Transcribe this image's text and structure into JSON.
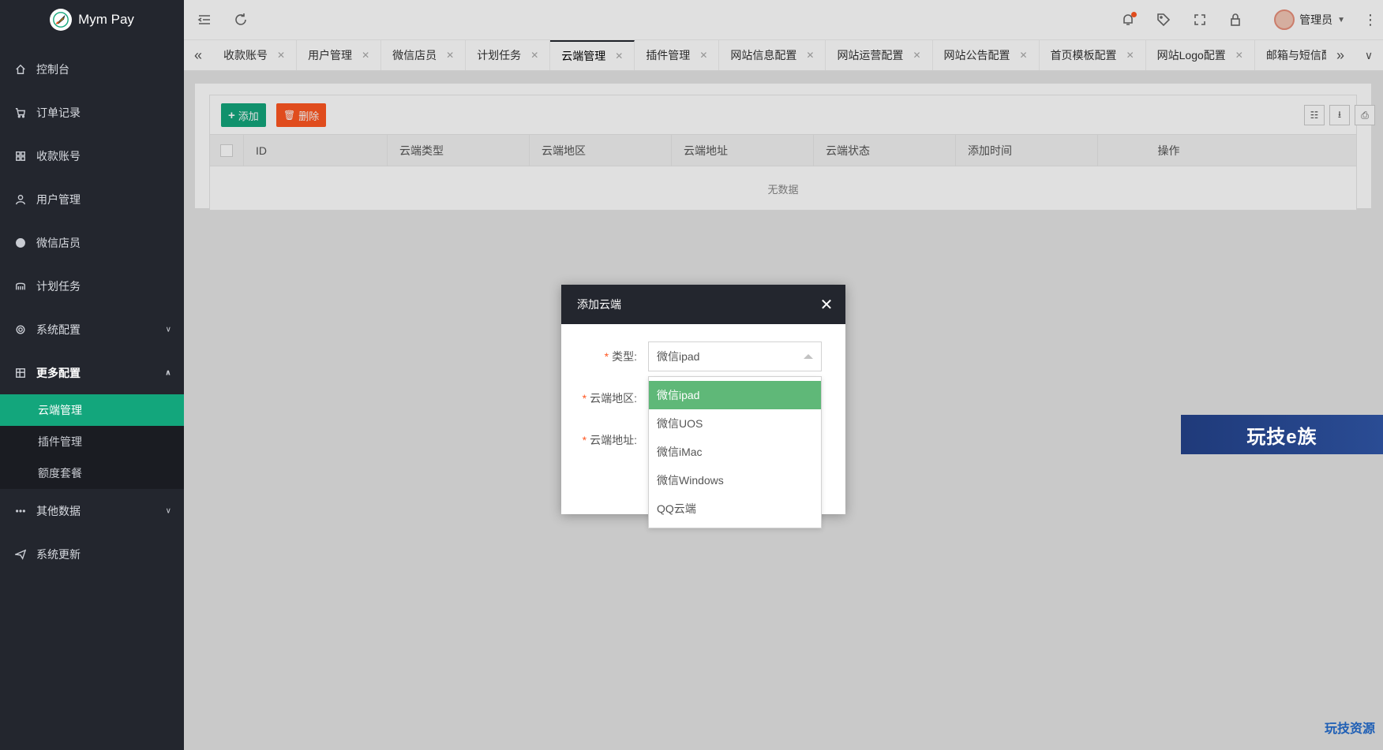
{
  "app": {
    "name": "Mym Pay"
  },
  "sidebar": {
    "items": [
      {
        "label": "控制台",
        "icon": "home-icon"
      },
      {
        "label": "订单记录",
        "icon": "cart-icon"
      },
      {
        "label": "收款账号",
        "icon": "apps-icon"
      },
      {
        "label": "用户管理",
        "icon": "user-icon"
      },
      {
        "label": "微信店员",
        "icon": "wechat-icon"
      },
      {
        "label": "计划任务",
        "icon": "group-icon"
      },
      {
        "label": "系统配置",
        "icon": "gear-icon",
        "expandable": true,
        "expanded": false
      },
      {
        "label": "更多配置",
        "icon": "grid-icon",
        "expandable": true,
        "expanded": true
      },
      {
        "label": "其他数据",
        "icon": "more-icon",
        "expandable": true,
        "expanded": false
      },
      {
        "label": "系统更新",
        "icon": "send-icon"
      }
    ],
    "sub_items": [
      {
        "label": "云端管理",
        "active": true
      },
      {
        "label": "插件管理",
        "active": false
      },
      {
        "label": "额度套餐",
        "active": false
      }
    ]
  },
  "header": {
    "user_name": "管理员",
    "has_notification": true
  },
  "tabs": [
    {
      "label": "收款账号",
      "active": false
    },
    {
      "label": "用户管理",
      "active": false
    },
    {
      "label": "微信店员",
      "active": false
    },
    {
      "label": "计划任务",
      "active": false
    },
    {
      "label": "云端管理",
      "active": true
    },
    {
      "label": "插件管理",
      "active": false
    },
    {
      "label": "网站信息配置",
      "active": false
    },
    {
      "label": "网站运营配置",
      "active": false
    },
    {
      "label": "网站公告配置",
      "active": false
    },
    {
      "label": "首页模板配置",
      "active": false
    },
    {
      "label": "网站Logo配置",
      "active": false
    },
    {
      "label": "邮箱与短信配置",
      "active": false
    }
  ],
  "toolbar": {
    "add_label": "添加",
    "delete_label": "删除"
  },
  "table": {
    "columns": [
      "ID",
      "云端类型",
      "云端地区",
      "云端地址",
      "云端状态",
      "添加时间",
      "操作"
    ],
    "empty_text": "无数据"
  },
  "modal": {
    "title": "添加云端",
    "fields": [
      {
        "label": "类型:",
        "required": true,
        "value": "微信ipad"
      },
      {
        "label": "云端地区:",
        "required": true
      },
      {
        "label": "云端地址:",
        "required": true
      }
    ],
    "type_options": [
      "微信ipad",
      "微信UOS",
      "微信iMac",
      "微信Windows",
      "QQ云端"
    ],
    "selected_option": "微信ipad"
  },
  "watermarks": {
    "banner": "玩技e族",
    "bottom": "玩技资源"
  },
  "colors": {
    "sidebar_bg": "#23262e",
    "accent_green": "#13a67c",
    "danger_orange": "#ff5722",
    "selected_option": "#5fb878"
  }
}
